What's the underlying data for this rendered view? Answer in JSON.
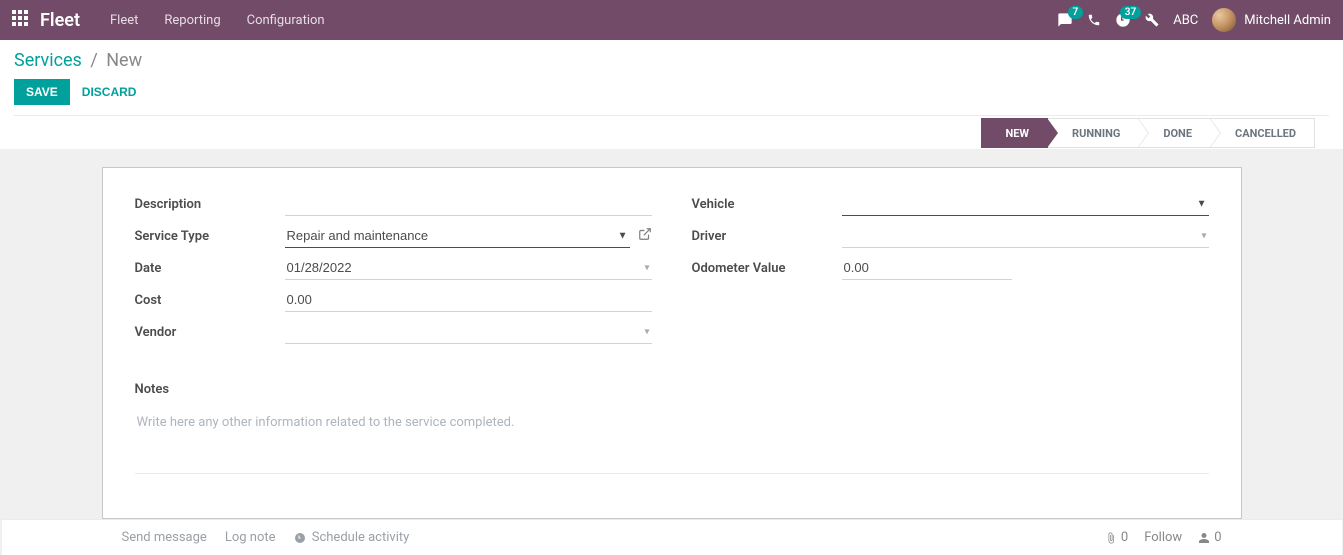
{
  "nav": {
    "brand": "Fleet",
    "menus": [
      "Fleet",
      "Reporting",
      "Configuration"
    ],
    "chat_badge": "7",
    "activity_badge": "37",
    "company": "ABC",
    "user": "Mitchell Admin"
  },
  "breadcrumb": {
    "root": "Services",
    "current": "New"
  },
  "buttons": {
    "save": "SAVE",
    "discard": "DISCARD"
  },
  "status": [
    "NEW",
    "RUNNING",
    "DONE",
    "CANCELLED"
  ],
  "status_active_index": 0,
  "form": {
    "labels": {
      "description": "Description",
      "service_type": "Service Type",
      "date": "Date",
      "cost": "Cost",
      "vendor": "Vendor",
      "vehicle": "Vehicle",
      "driver": "Driver",
      "odometer": "Odometer Value",
      "notes": "Notes"
    },
    "values": {
      "description": "",
      "service_type": "Repair and maintenance",
      "date": "01/28/2022",
      "cost": "0.00",
      "vendor": "",
      "vehicle": "",
      "driver": "",
      "odometer": "0.00"
    },
    "notes_placeholder": "Write here any other information related to the service completed."
  },
  "chatter": {
    "send": "Send message",
    "log": "Log note",
    "schedule": "Schedule activity",
    "attachments": "0",
    "follow": "Follow",
    "followers": "0"
  }
}
